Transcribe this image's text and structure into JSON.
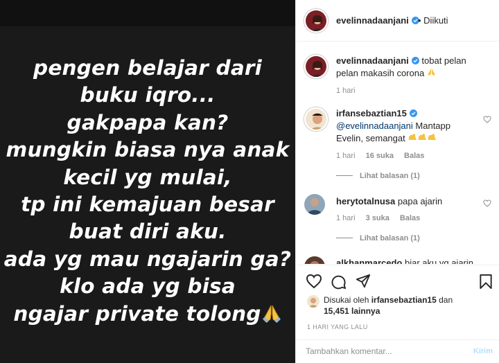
{
  "story": {
    "lines": [
      "pengen belajar dari",
      "buku iqro...",
      "gakpapa kan?",
      "mungkin biasa nya anak",
      "kecil yg mulai,",
      "tp ini kemajuan besar",
      "buat diri aku.",
      "ada yg mau ngajarin ga?",
      "klo ada yg bisa",
      "ngajar private tolong"
    ],
    "emoji": "folded-hands"
  },
  "header": {
    "username": "evelinnadaanjani",
    "follow_status": "• Diikuti"
  },
  "caption": {
    "username": "evelinnadaanjani",
    "text": "tobat pelan pelan makasih corona",
    "time": "1 hari"
  },
  "comments": [
    {
      "username": "irfansebaztian15",
      "mention": "@evelinnadaanjani",
      "text": "Mantapp Evelin, semangat",
      "time": "1 hari",
      "likes": "16 suka",
      "reply": "Balas",
      "view_replies": "Lihat balasan (1)"
    },
    {
      "username": "herytotalnusa",
      "text": "papa ajarin",
      "time": "1 hari",
      "likes": "3 suka",
      "reply": "Balas",
      "view_replies": "Lihat balasan (1)"
    },
    {
      "username": "alkhanmarcedo",
      "text": "biar aku yg ajarin"
    }
  ],
  "likes": {
    "prefix": "Disukai oleh",
    "user": "irfansebaztian15",
    "and": "dan",
    "count": "15,451 lainnya"
  },
  "time_ago": "1 HARI YANG LALU",
  "add_comment": {
    "placeholder": "Tambahkan komentar...",
    "post_label": "Kirim"
  },
  "colors": {
    "verified": "#3897f0",
    "story_bg": "#1a1a1a",
    "post_disabled": "#b2dffc"
  }
}
